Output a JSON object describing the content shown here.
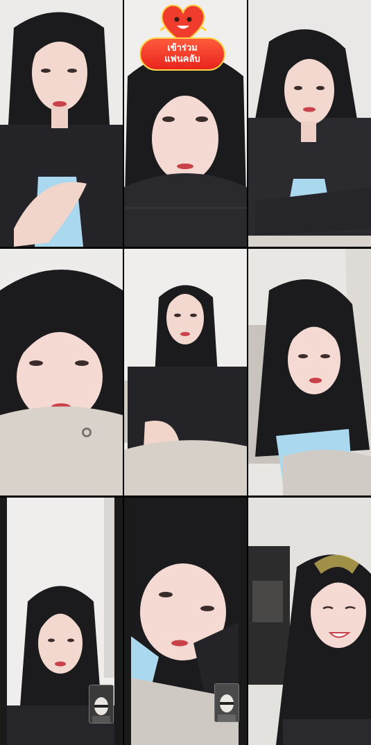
{
  "fan_club_badge": {
    "line1": "เข้าร่วม",
    "line2": "แฟนคลับ"
  },
  "colors": {
    "background": "#000000",
    "badge_red": "#e8241c",
    "badge_border": "#ffd84a",
    "hair": "#1b1b1e",
    "skin": "#f3d8cf",
    "cardigan": "#222226",
    "top_blue": "#a9d8ef"
  },
  "tiles": [
    {
      "icon": "video-frame"
    },
    {
      "icon": "video-frame-with-fan-badge"
    },
    {
      "icon": "video-frame"
    },
    {
      "icon": "video-frame"
    },
    {
      "icon": "video-frame"
    },
    {
      "icon": "video-frame"
    },
    {
      "icon": "video-frame-with-pip"
    },
    {
      "icon": "video-frame-with-pip"
    },
    {
      "icon": "video-frame"
    }
  ]
}
